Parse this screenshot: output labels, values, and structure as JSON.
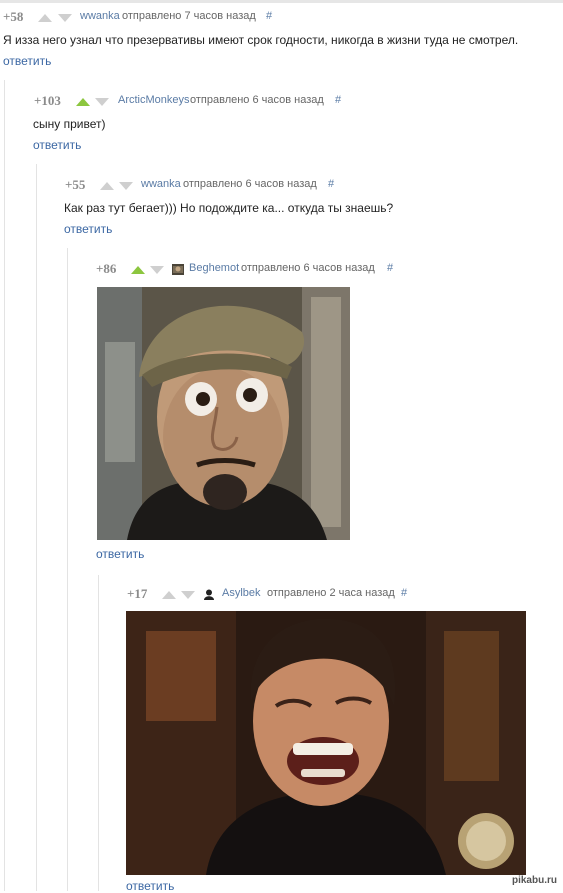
{
  "comments": [
    {
      "score": "+58",
      "author": "wwanka",
      "posted": "отправлено 7 часов назад",
      "hash": "#",
      "text": "Я изза него узнал что презервативы имеют срок годности, никогда в жизни туда не смотрел.",
      "reply": "ответить",
      "vote": "none"
    },
    {
      "score": "+103",
      "author": "ArcticMonkeys",
      "posted": "отправлено 6 часов назад",
      "hash": "#",
      "text": "сыну привет)",
      "reply": "ответить",
      "vote": "up"
    },
    {
      "score": "+55",
      "author": "wwanka",
      "posted": "отправлено 6 часов назад",
      "hash": "#",
      "text": "Как раз тут бегает))) Но подождите ка... откуда ты знаешь?",
      "reply": "ответить",
      "vote": "none"
    },
    {
      "score": "+86",
      "author": "Beghemot",
      "posted": "отправлено 6 часов назад",
      "hash": "#",
      "image": "surprised-man-in-cap-photo",
      "reply": "ответить",
      "vote": "up"
    },
    {
      "score": "+17",
      "author": "Asylbek",
      "posted": "отправлено 2 часа назад",
      "hash": "#",
      "image": "laughing-man-photo",
      "reply": "ответить",
      "vote": "none"
    }
  ],
  "watermark": "pikabu.ru",
  "colors": {
    "author_link": "#5a7ba5",
    "reply_link": "#3b67a3",
    "upvote_active": "#8cc63f",
    "arrow_inactive": "#cfcfcf",
    "score": "#8b8b8b"
  }
}
